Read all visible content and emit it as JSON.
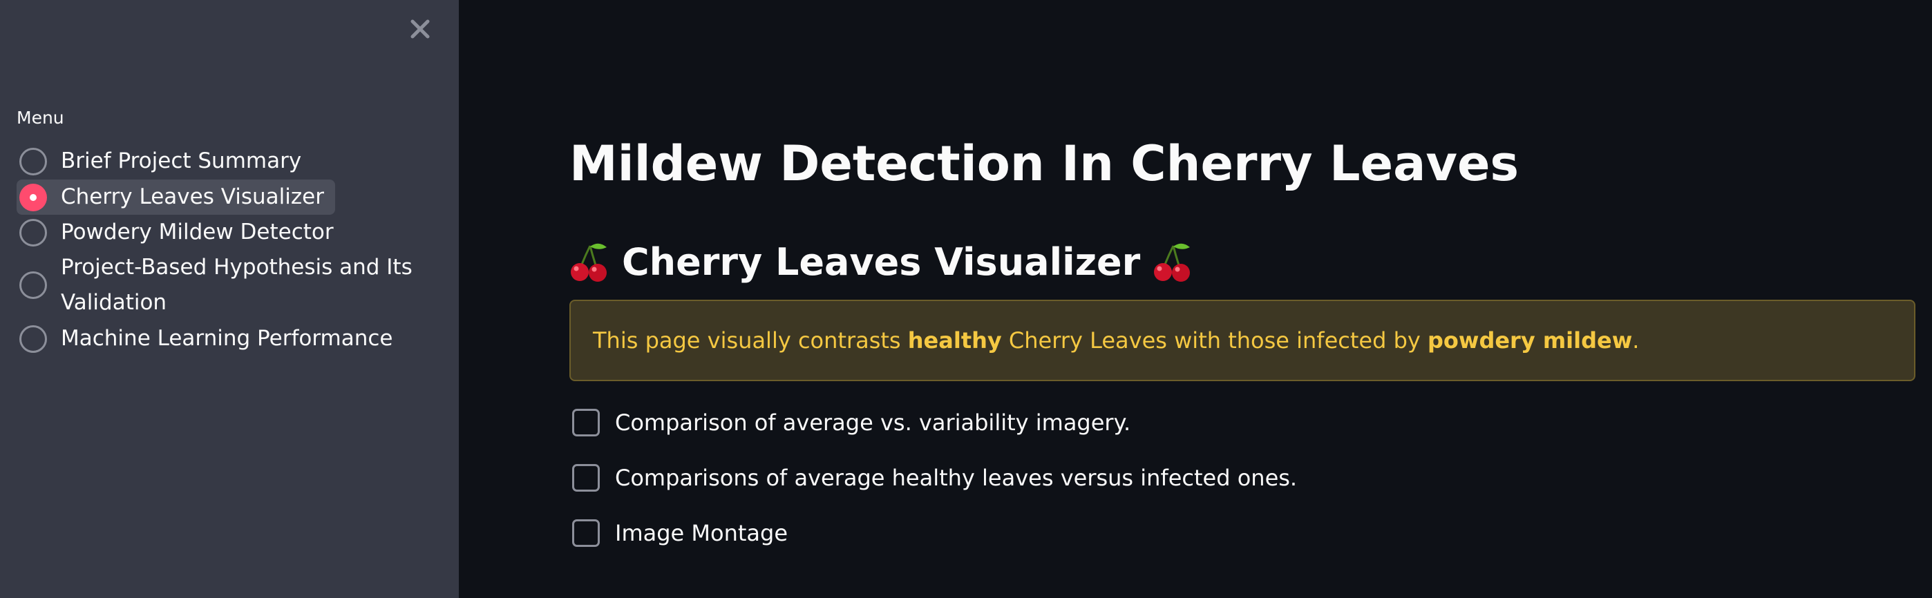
{
  "sidebar": {
    "close_icon": "close-icon",
    "menu_label": "Menu",
    "items": [
      {
        "label": "Brief Project Summary",
        "selected": false
      },
      {
        "label": "Cherry Leaves Visualizer",
        "selected": true
      },
      {
        "label": "Powdery Mildew Detector",
        "selected": false
      },
      {
        "label_line1": "Project-Based Hypothesis and Its",
        "label_line2": "Validation",
        "selected": false
      },
      {
        "label": "Machine Learning Performance",
        "selected": false
      }
    ]
  },
  "main": {
    "title": "Mildew Detection In Cherry Leaves",
    "subheader": {
      "icon": "cherries-icon",
      "text": "Cherry Leaves Visualizer"
    },
    "alert": {
      "part1": "This page visually contrasts ",
      "bold1": "healthy",
      "part2": " Cherry Leaves with those infected by ",
      "bold2": "powdery mildew",
      "part3": "."
    },
    "checkboxes": [
      {
        "label": "Comparison of average vs. variability imagery.",
        "checked": false
      },
      {
        "label": "Comparisons of average healthy leaves versus infected ones.",
        "checked": false
      },
      {
        "label": "Image Montage",
        "checked": false
      }
    ]
  },
  "colors": {
    "sidebar_bg": "#363945",
    "main_bg": "#0e1117",
    "accent": "#ff4b6e",
    "alert_bg": "#3d3723",
    "alert_text": "#f5c842"
  }
}
